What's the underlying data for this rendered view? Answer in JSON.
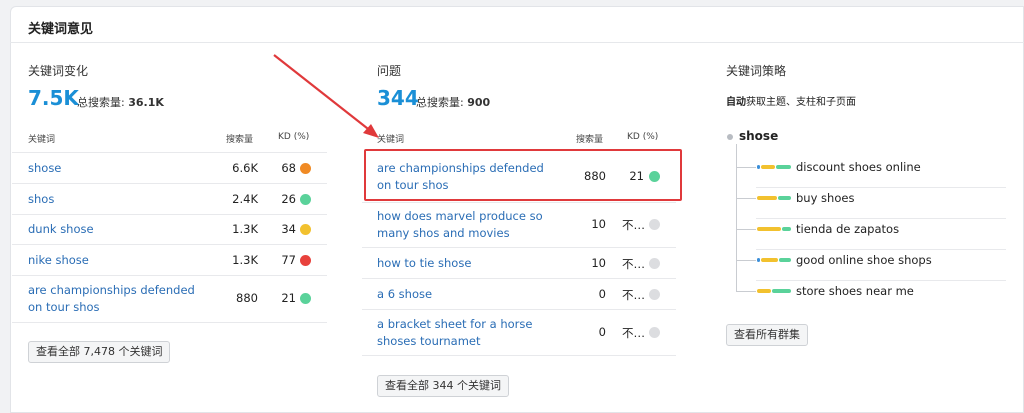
{
  "card": {
    "title": "关键词意见"
  },
  "variations": {
    "title": "关键词变化",
    "count": "7.5K",
    "total_label": "总搜索量:",
    "total_value": "36.1K",
    "headers": {
      "keyword": "关键词",
      "volume": "搜索量",
      "kd": "KD (%)"
    },
    "rows": [
      {
        "keyword": "shose",
        "volume": "6.6K",
        "kd": "68",
        "kd_color": "#f08a24"
      },
      {
        "keyword": "shos",
        "volume": "2.4K",
        "kd": "26",
        "kd_color": "#5ad29a"
      },
      {
        "keyword": "dunk shose",
        "volume": "1.3K",
        "kd": "34",
        "kd_color": "#f2c12e"
      },
      {
        "keyword": "nike shose",
        "volume": "1.3K",
        "kd": "77",
        "kd_color": "#e8413c"
      },
      {
        "keyword": "are championships defended on tour shos",
        "volume": "880",
        "kd": "21",
        "kd_color": "#5ad29a"
      }
    ],
    "button": "查看全部 7,478 个关键词"
  },
  "questions": {
    "title": "问题",
    "count": "344",
    "total_label": "总搜索量:",
    "total_value": "900",
    "headers": {
      "keyword": "关键词",
      "volume": "搜索量",
      "kd": "KD (%)"
    },
    "rows": [
      {
        "keyword": "are championships defended on tour shos",
        "volume": "880",
        "kd": "21",
        "kd_color": "#5ad29a"
      },
      {
        "keyword": "how does marvel produce so many shos and movies",
        "volume": "10",
        "kd": "不…",
        "kd_color": "#dcdde0"
      },
      {
        "keyword": "how to tie shose",
        "volume": "10",
        "kd": "不…",
        "kd_color": "#dcdde0"
      },
      {
        "keyword": "a 6 shose",
        "volume": "0",
        "kd": "不…",
        "kd_color": "#dcdde0"
      },
      {
        "keyword": "a bracket sheet for a horse shoses tournamet",
        "volume": "0",
        "kd": "不…",
        "kd_color": "#dcdde0"
      }
    ],
    "button": "查看全部 344 个关键词"
  },
  "strategy": {
    "title": "关键词策略",
    "subtitle_bold": "自动",
    "subtitle_rest": "获取主题、支柱和子页面",
    "root": "shose",
    "items": [
      {
        "label": "discount shoes online",
        "colors": [
          "#3b8fd9",
          "#f2c12e",
          "#5ad29a"
        ]
      },
      {
        "label": "buy shoes",
        "colors": [
          "#f2c12e",
          "#5ad29a"
        ]
      },
      {
        "label": "tienda de zapatos",
        "colors": [
          "#f2c12e",
          "#5ad29a"
        ]
      },
      {
        "label": "good online shoe shops",
        "colors": [
          "#3b8fd9",
          "#f2c12e",
          "#5ad29a"
        ]
      },
      {
        "label": "store shoes near me",
        "colors": [
          "#f2c12e",
          "#5ad29a"
        ]
      }
    ],
    "button": "查看所有群集"
  }
}
